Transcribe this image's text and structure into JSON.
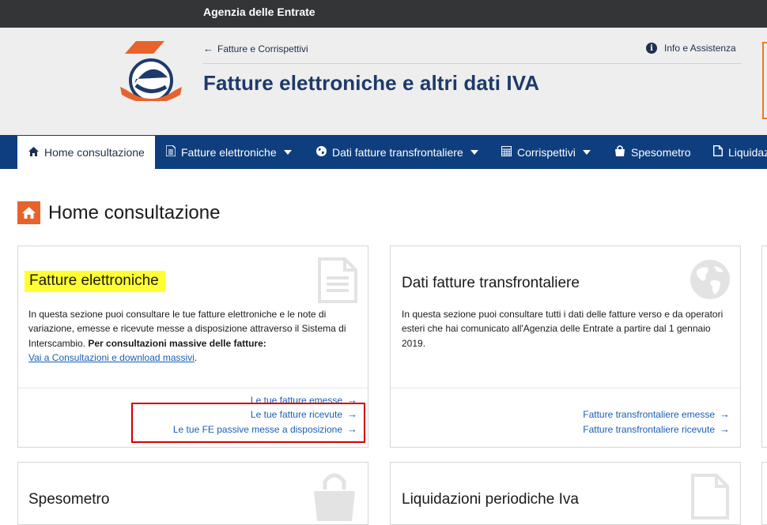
{
  "topbar": {
    "agency": "Agenzia delle Entrate"
  },
  "header": {
    "back_link": "Fatture e Corrispettivi",
    "info_link": "Info e Assistenza",
    "title": "Fatture elettroniche e altri dati IVA"
  },
  "nav": {
    "items": [
      {
        "label": "Home consultazione",
        "icon": "home-icon"
      },
      {
        "label": "Fatture elettroniche",
        "icon": "document-icon"
      },
      {
        "label": "Dati fatture transfrontaliere",
        "icon": "globe-icon"
      },
      {
        "label": "Corrispettivi",
        "icon": "calculator-icon"
      },
      {
        "label": "Spesometro",
        "icon": "shopping-bag-icon"
      },
      {
        "label": "Liquidaz",
        "icon": "file-icon"
      }
    ]
  },
  "page": {
    "heading": "Home consultazione"
  },
  "cards": {
    "fatture": {
      "title": "Fatture elettroniche",
      "text": "In questa sezione puoi consultare le tue fatture elettroniche e le note di variazione, emesse e ricevute messe a disposizione attraverso il Sistema di Interscambio.",
      "bold": "Per consultazioni massive delle fatture:",
      "massive_link": "Vai a Consultazioni e download massivi",
      "links": [
        "Le tue fatture emesse",
        "Le tue fatture ricevute",
        "Le tue FE passive messe a disposizione"
      ]
    },
    "transfrontaliere": {
      "title": "Dati fatture transfrontaliere",
      "text": "In questa sezione puoi consultare tutti i dati delle fatture verso e da operatori esteri che hai comunicato all'Agenzia delle Entrate a partire dal 1 gennaio 2019.",
      "links": [
        "Fatture transfrontaliere emesse",
        "Fatture transfrontaliere ricevute"
      ]
    },
    "spesometro": {
      "title": "Spesometro"
    },
    "liquidazioni": {
      "title": "Liquidazioni periodiche Iva"
    }
  },
  "colors": {
    "nav_bg": "#0e3e7e",
    "accent_orange": "#e8622c",
    "highlight": "#ffff33",
    "link": "#1a5fb4",
    "annotation_red": "#d10000"
  }
}
